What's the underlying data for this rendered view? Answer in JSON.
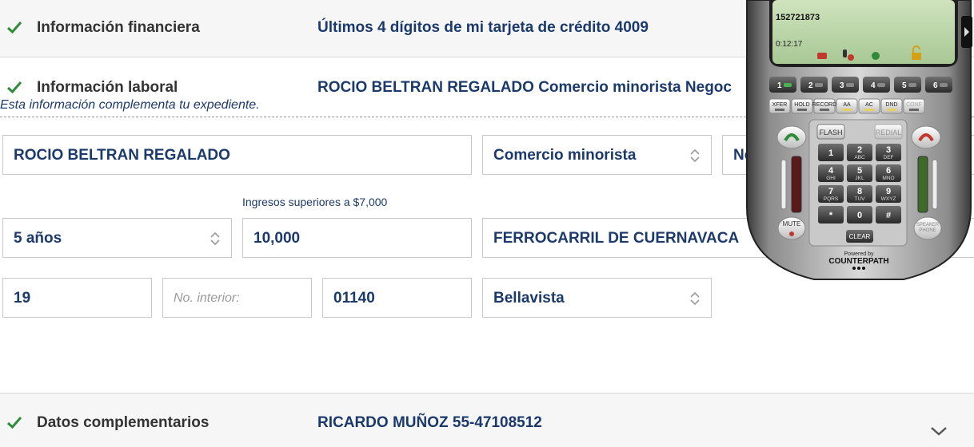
{
  "sections": {
    "financial": {
      "title": "Información financiera",
      "summary": "Últimos 4 dígitos de mi tarjeta de crédito 4009"
    },
    "work": {
      "title": "Información laboral",
      "summary": "ROCIO BELTRAN REGALADO Comercio minorista Negoc",
      "note": "Esta información complementa tu expediente."
    },
    "extra": {
      "title": "Datos complementarios",
      "summary": "RICARDO MUÑOZ 55-47108512"
    }
  },
  "form": {
    "employer_name": "ROCIO BELTRAN REGALADO",
    "industry": "Comercio minorista",
    "position_partial": "Ne",
    "income_hint": "Ingresos superiores a $7,000",
    "seniority": "5 años",
    "income": "10,000",
    "street": "FERROCARRIL DE CUERNAVACA",
    "ext_number": "19",
    "int_number_placeholder": "No. interior:",
    "zip": "01140",
    "neighborhood": "Bellavista"
  },
  "softphone": {
    "number": "152721873",
    "timer": "0:12:17",
    "lines": [
      "1",
      "2",
      "3",
      "4",
      "5",
      "6"
    ],
    "functions": [
      "XFER",
      "HOLD",
      "RECORD",
      "AA",
      "AC",
      "DND",
      "CONF"
    ],
    "flash": "FLASH",
    "redial": "REDIAL",
    "keys": [
      {
        "d": "1",
        "l": ""
      },
      {
        "d": "2",
        "l": "ABC"
      },
      {
        "d": "3",
        "l": "DEF"
      },
      {
        "d": "4",
        "l": "GHI"
      },
      {
        "d": "5",
        "l": "JKL"
      },
      {
        "d": "6",
        "l": "MNO"
      },
      {
        "d": "7",
        "l": "PQRS"
      },
      {
        "d": "8",
        "l": "TUV"
      },
      {
        "d": "9",
        "l": "WXYZ"
      },
      {
        "d": "*",
        "l": ""
      },
      {
        "d": "0",
        "l": ""
      },
      {
        "d": "#",
        "l": ""
      }
    ],
    "clear": "CLEAR",
    "mute": "MUTE",
    "speaker_1": "SPEAKER",
    "speaker_2": "PHONE",
    "powered_by": "Powered by",
    "brand": "COUNTERPATH"
  },
  "colors": {
    "accent": "#1b3a6b",
    "check": "#2e8b3a"
  }
}
